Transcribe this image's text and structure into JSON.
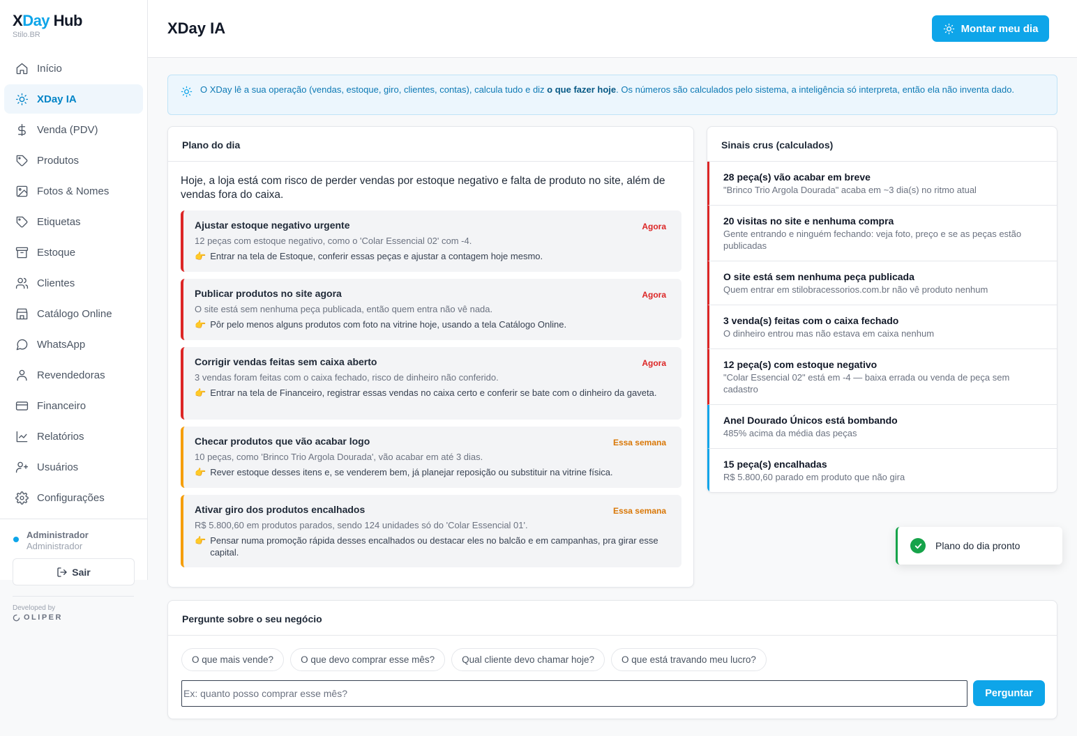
{
  "brand": {
    "name_a": "X",
    "name_b": "Day",
    "name_c": " Hub",
    "subtitle": "Stilo.BR"
  },
  "nav": [
    {
      "label": "Início",
      "icon": "home-icon",
      "active": false
    },
    {
      "label": "XDay IA",
      "icon": "sun-icon",
      "active": true
    },
    {
      "label": "Venda (PDV)",
      "icon": "dollar-icon",
      "active": false
    },
    {
      "label": "Produtos",
      "icon": "tag-icon",
      "active": false
    },
    {
      "label": "Fotos & Nomes",
      "icon": "image-icon",
      "active": false
    },
    {
      "label": "Etiquetas",
      "icon": "tag-icon",
      "active": false
    },
    {
      "label": "Estoque",
      "icon": "archive-icon",
      "active": false
    },
    {
      "label": "Clientes",
      "icon": "users-icon",
      "active": false
    },
    {
      "label": "Catálogo Online",
      "icon": "store-icon",
      "active": false
    },
    {
      "label": "WhatsApp",
      "icon": "chat-icon",
      "active": false
    },
    {
      "label": "Revendedoras",
      "icon": "user-icon",
      "active": false
    },
    {
      "label": "Financeiro",
      "icon": "credit-card-icon",
      "active": false
    },
    {
      "label": "Relatórios",
      "icon": "chart-line-icon",
      "active": false
    },
    {
      "label": "Usuários",
      "icon": "user-plus-icon",
      "active": false
    },
    {
      "label": "Configurações",
      "icon": "gear-icon",
      "active": false
    }
  ],
  "user": {
    "name": "Administrador",
    "role": "Administrador",
    "logout_label": "Sair"
  },
  "developer": {
    "by": "Developed by",
    "name": "OLIPER"
  },
  "header": {
    "title": "XDay IA",
    "montar_label": "Montar meu dia"
  },
  "info": {
    "text_before": "O XDay lê a sua operação (vendas, estoque, giro, clientes, contas), calcula tudo e diz ",
    "text_bold": "o que fazer hoje",
    "text_after": ". Os números são calculados pelo sistema, a inteligência só interpreta, então ela não inventa dado."
  },
  "plan": {
    "title": "Plano do dia",
    "summary": "Hoje, a loja está com risco de perder vendas por estoque negativo e falta de produto no site, além de vendas fora do caixa.",
    "tasks": [
      {
        "title": "Ajustar estoque negativo urgente",
        "badge": "Agora",
        "priority": "now",
        "desc": "12 peças com estoque negativo, como o 'Colar Essencial 02' com -4.",
        "action": "Entrar na tela de Estoque, conferir essas peças e ajustar a contagem hoje mesmo."
      },
      {
        "title": "Publicar produtos no site agora",
        "badge": "Agora",
        "priority": "now",
        "desc": "O site está sem nenhuma peça publicada, então quem entra não vê nada.",
        "action": "Pôr pelo menos alguns produtos com foto na vitrine hoje, usando a tela Catálogo Online."
      },
      {
        "title": "Corrigir vendas feitas sem caixa aberto",
        "badge": "Agora",
        "priority": "now",
        "desc": "3 vendas foram feitas com o caixa fechado, risco de dinheiro não conferido.",
        "action": "Entrar na tela de Financeiro, registrar essas vendas no caixa certo e conferir se bate com o dinheiro da gaveta."
      },
      {
        "title": "Checar produtos que vão acabar logo",
        "badge": "Essa semana",
        "priority": "week",
        "desc": "10 peças, como 'Brinco Trio Argola Dourada', vão acabar em até 3 dias.",
        "action": "Rever estoque desses itens e, se venderem bem, já planejar reposição ou substituir na vitrine física."
      },
      {
        "title": "Ativar giro dos produtos encalhados",
        "badge": "Essa semana",
        "priority": "week",
        "desc": "R$ 5.800,60 em produtos parados, sendo 124 unidades só do 'Colar Essencial 01'.",
        "action": "Pensar numa promoção rápida desses encalhados ou destacar eles no balcão e em campanhas, pra girar esse capital."
      }
    ]
  },
  "signals": {
    "title": "Sinais crus (calculados)",
    "items": [
      {
        "title": "28 peça(s) vão acabar em breve",
        "desc": "\"Brinco Trio Argola Dourada\" acaba em ~3 dia(s) no ritmo atual",
        "tone": "red"
      },
      {
        "title": "20 visitas no site e nenhuma compra",
        "desc": "Gente entrando e ninguém fechando: veja foto, preço e se as peças estão publicadas",
        "tone": "red"
      },
      {
        "title": "O site está sem nenhuma peça publicada",
        "desc": "Quem entrar em stilobracessorios.com.br não vê produto nenhum",
        "tone": "red"
      },
      {
        "title": "3 venda(s) feitas com o caixa fechado",
        "desc": "O dinheiro entrou mas não estava em caixa nenhum",
        "tone": "red"
      },
      {
        "title": "12 peça(s) com estoque negativo",
        "desc": "\"Colar Essencial 02\" está em -4 — baixa errada ou venda de peça sem cadastro",
        "tone": "red"
      },
      {
        "title": "Anel Dourado Únicos está bombando",
        "desc": "485% acima da média das peças",
        "tone": "blue"
      },
      {
        "title": "15 peça(s) encalhadas",
        "desc": "R$ 5.800,60 parado em produto que não gira",
        "tone": "blue"
      }
    ]
  },
  "toast": {
    "text": "Plano do dia pronto"
  },
  "ask": {
    "title": "Pergunte sobre o seu negócio",
    "chips": [
      "O que mais vende?",
      "O que devo comprar esse mês?",
      "Qual cliente devo chamar hoje?",
      "O que está travando meu lucro?"
    ],
    "placeholder": "Ex: quanto posso comprar esse mês?",
    "button_label": "Perguntar"
  },
  "colors": {
    "accent": "#0ea5e9",
    "danger": "#dc2626",
    "warning": "#f59e0b",
    "success": "#16a34a"
  }
}
